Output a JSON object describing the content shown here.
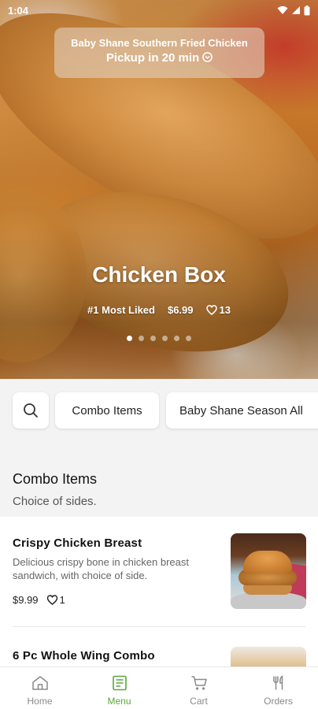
{
  "status": {
    "time": "1:04"
  },
  "hero": {
    "restaurant": "Baby Shane Southern Fried Chicken",
    "pickup": "Pickup in 20 min",
    "title": "Chicken Box",
    "rank": "#1 Most Liked",
    "price": "$6.99",
    "likes": "13",
    "slides_total": 6,
    "slide_active": 1
  },
  "filters": [
    "Combo Items",
    "Baby Shane Season All"
  ],
  "section": {
    "title": "Combo Items",
    "subtitle": "Choice of sides."
  },
  "items": [
    {
      "name": "Crispy Chicken Breast",
      "description": "Delicious crispy bone in chicken breast sandwich, with choice of side.",
      "price": "$9.99",
      "likes": "1"
    },
    {
      "name": "6 Pc Whole Wing Combo"
    }
  ],
  "nav": [
    {
      "label": "Home",
      "icon": "home-icon"
    },
    {
      "label": "Menu",
      "icon": "menu-icon"
    },
    {
      "label": "Cart",
      "icon": "cart-icon"
    },
    {
      "label": "Orders",
      "icon": "fork-knife-icon"
    }
  ],
  "colors": {
    "accent": "#58a83a"
  }
}
